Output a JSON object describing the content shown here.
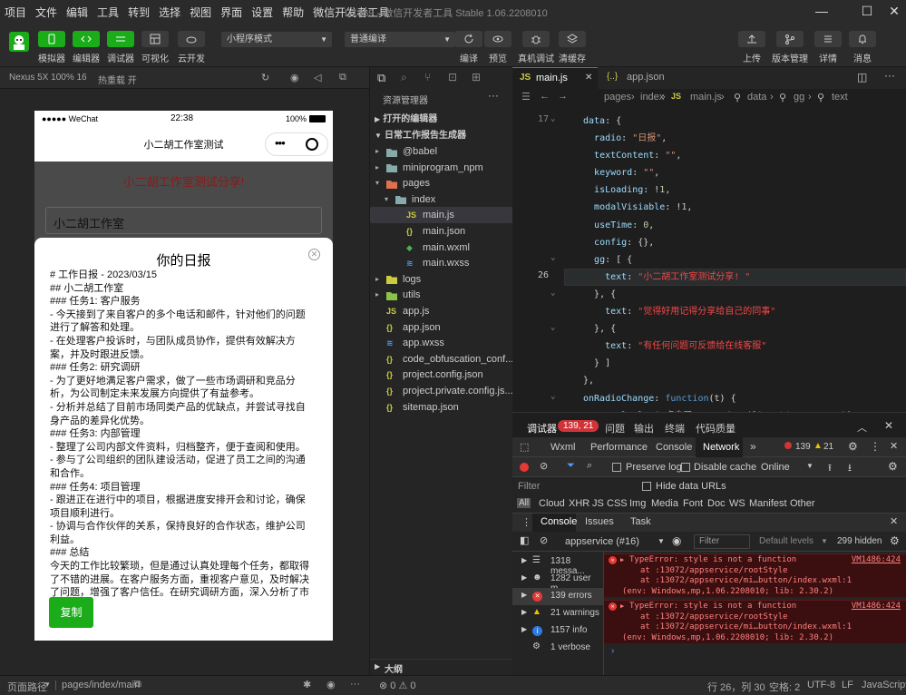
{
  "menu": [
    "项目",
    "文件",
    "编辑",
    "工具",
    "转到",
    "选择",
    "视图",
    "界面",
    "设置",
    "帮助",
    "微信开发者工具"
  ],
  "window_title": "D1369 - 微信开发者工具 Stable 1.06.2208010",
  "toolbar": {
    "simulator": "模拟器",
    "editor": "编辑器",
    "debugger": "调试器",
    "visual": "可视化",
    "cloud": "云开发",
    "mode": "小程序模式",
    "compile_mode": "普通编译",
    "compile": "编译",
    "preview": "预览",
    "real_debug": "真机调试",
    "clear_cache": "清缓存",
    "upload": "上传",
    "version": "版本管理",
    "details": "详情",
    "messages": "消息"
  },
  "simbar": {
    "device": "Nexus 5X 100% 16",
    "hot_reload": "热重载 开"
  },
  "phone": {
    "status_carrier": "●●●●● WeChat",
    "status_time": "22:38",
    "status_battery": "100%",
    "nav_title": "小二胡工作室测试",
    "share_text": "小二胡工作室测试分享!",
    "input_value": "小二胡工作室",
    "modal_title": "你的日报",
    "copy_button": "复制",
    "report": [
      "# 工作日报 - 2023/03/15",
      "## 小二胡工作室",
      "### 任务1: 客户服务",
      "- 今天接到了来自客户的多个电话和邮件，针对他们的问题进行了解答和处理。",
      "- 在处理客户投诉时，与团队成员协作，提供有效解决方案，并及时跟进反馈。",
      "### 任务2: 研究调研",
      "- 为了更好地满足客户需求，做了一些市场调研和竞品分析，为公司制定未来发展方向提供了有益参考。",
      "- 分析并总结了目前市场同类产品的优缺点，并尝试寻找自身产品的差异化优势。",
      "### 任务3: 内部管理",
      "- 整理了公司内部文件资料，归档整齐，便于查阅和使用。",
      "- 参与了公司组织的团队建设活动，促进了员工之间的沟通和合作。",
      "### 任务4: 项目管理",
      "- 跟进正在进行中的项目，根据进度安排开会和讨论，确保项目顺利进行。",
      "- 协调与合作伙伴的关系，保持良好的合作状态，维护公司利益。",
      "### 总结",
      "今天的工作比较繁琐，但是通过认真处理每个任务，都取得了不错的进展。在客户服务方面，重视客户意见，及时解决了问题，增强了客户信任。在研究调研方面，深入分析了市"
    ]
  },
  "explorer": {
    "title": "资源管理器",
    "open_editors": "打开的编辑器",
    "project": "日常工作报告生成器",
    "items": [
      "@babel",
      "miniprogram_npm",
      "pages",
      "index",
      "main.js",
      "main.json",
      "main.wxml",
      "main.wxss",
      "logs",
      "utils",
      "app.js",
      "app.json",
      "app.wxss",
      "code_obfuscation_conf...",
      "project.config.json",
      "project.private.config.js...",
      "sitemap.json"
    ],
    "outline": "大纲",
    "problems": "⊗ 0 ⚠ 0"
  },
  "editor": {
    "tab1": "main.js",
    "tab2": "app.json",
    "breadcrumb": [
      "pages",
      "index",
      "main.js",
      "data",
      "gg",
      "text"
    ],
    "line_numbers": [
      "17",
      "",
      "",
      "",
      "",
      "",
      "",
      "",
      "",
      "",
      "26",
      "",
      "",
      "",
      "",
      "",
      "",
      "",
      "",
      ""
    ]
  },
  "debug": {
    "tabs": [
      "调试器",
      "问题",
      "输出",
      "终端",
      "代码质量"
    ],
    "badge": "139, 21",
    "dev_tabs": [
      "Wxml",
      "Performance",
      "Console",
      "Network"
    ],
    "errors_count": "139",
    "warnings_count": "21",
    "network": {
      "preserve": "Preserve log",
      "disable_cache": "Disable cache",
      "online": "Online",
      "filter": "Filter",
      "hide_data": "Hide data URLs",
      "types": [
        "All",
        "Cloud",
        "XHR",
        "JS",
        "CSS",
        "Img",
        "Media",
        "Font",
        "Doc",
        "WS",
        "Manifest",
        "Other"
      ]
    },
    "console_tabs": [
      "Console",
      "Issues",
      "Task"
    ],
    "context": "appservice (#16)",
    "filter": "Filter",
    "levels": "Default levels",
    "hidden": "299 hidden",
    "sidebar": [
      "1318 messa...",
      "1282 user m...",
      "139 errors",
      "21 warnings",
      "1157 info",
      "1 verbose"
    ],
    "errors": [
      {
        "msg": "TypeError: style is not a function",
        "loc": "VM1486:424",
        "l1": "at :13072/appservice/rootStyle",
        "l2": "at :13072/appservice/mi…button/index.wxml:1",
        "env": "(env: Windows,mp,1.06.2208010; lib: 2.30.2)"
      },
      {
        "msg": "TypeError: style is not a function",
        "loc": "VM1486:424",
        "l1": "at :13072/appservice/rootStyle",
        "l2": "at :13072/appservice/mi…button/index.wxml:1",
        "env": "(env: Windows,mp,1.06.2208010; lib: 2.30.2)"
      }
    ]
  },
  "status": {
    "path_label": "页面路径",
    "path": "pages/index/main",
    "pos": "行 26，列 30",
    "spaces": "空格: 2",
    "enc": "UTF-8",
    "eol": "LF",
    "lang": "JavaScript"
  }
}
